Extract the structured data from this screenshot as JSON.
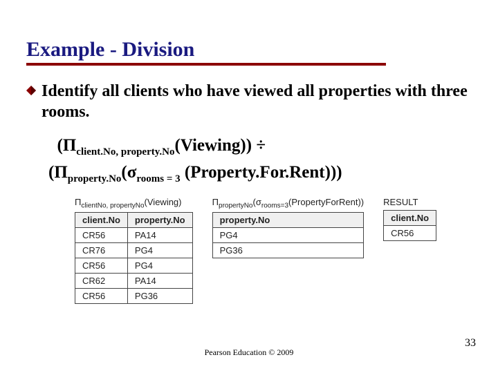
{
  "title": "Example - Division",
  "bullet": "Identify all clients who have viewed all properties with three rooms.",
  "expr": {
    "pi": "Π",
    "sigma": "σ",
    "div": "÷",
    "sub1": "client.No, property.No",
    "arg1": "(Viewing)) ",
    "sub2": "property.No",
    "sub3": "rooms = 3",
    "arg2": " (Property.For.Rent)))"
  },
  "tables": {
    "viewing": {
      "caption_pi": "Π",
      "caption_sub": "clientNo, propertyNo",
      "caption_arg": "(Viewing)",
      "headers": [
        "client.No",
        "property.No"
      ],
      "rows": [
        [
          "CR56",
          "PA14"
        ],
        [
          "CR76",
          "PG4"
        ],
        [
          "CR56",
          "PG4"
        ],
        [
          "CR62",
          "PA14"
        ],
        [
          "CR56",
          "PG36"
        ]
      ]
    },
    "property": {
      "caption_pi": "Π",
      "caption_sub1": "propertyNo",
      "caption_sigma": "σ",
      "caption_sub2": "rooms=3",
      "caption_arg": "(PropertyForRent))",
      "headers": [
        "property.No"
      ],
      "rows": [
        [
          "PG4"
        ],
        [
          "PG36"
        ]
      ]
    },
    "result": {
      "caption": "RESULT",
      "headers": [
        "client.No"
      ],
      "rows": [
        [
          "CR56"
        ]
      ]
    }
  },
  "footer": "Pearson Education © 2009",
  "pagenum": "33"
}
